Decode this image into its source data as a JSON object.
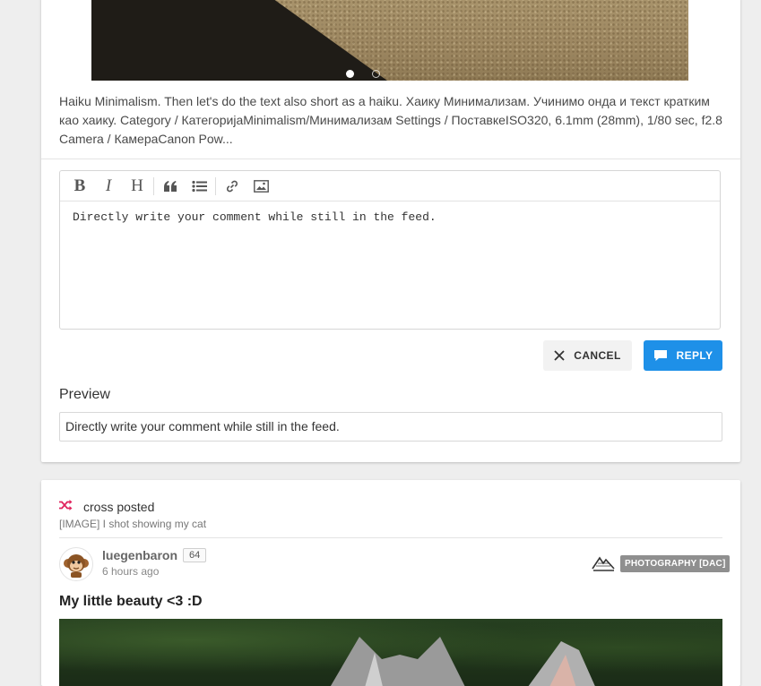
{
  "feed_post": {
    "carousel": {
      "slide_count": 2,
      "active_slide": 1
    },
    "excerpt": "Haiku Minimalism. Then let's do the text also short as a haiku. Хаику Минимализам. Учинимо онда и текст кратким као хаику. Category / КатегоријаMinimalism/Минимализам Settings / ПоставкеISO320, 6.1mm (28mm), 1/80 sec, f2.8 Camera / КамераCanon Pow..."
  },
  "comment_editor": {
    "toolbar_icons": [
      "bold-icon",
      "italic-icon",
      "heading-icon",
      "quote-icon",
      "unordered-list-icon",
      "link-icon",
      "image-icon"
    ],
    "toolbar_text": {
      "bold": "B",
      "italic": "I",
      "heading": "H"
    },
    "text": "Directly write your comment while still in the feed.",
    "cancel_label": "CANCEL",
    "reply_label": "REPLY",
    "preview_title": "Preview",
    "preview_text": "Directly write your comment while still in the feed."
  },
  "crosspost": {
    "label": "cross posted",
    "source": "[IMAGE] I shot showing my cat",
    "author": "luegenbaron",
    "reputation": "64",
    "time": "6 hours ago",
    "community": "PHOTOGRAPHY [DAC]",
    "title": "My little beauty <3 :D"
  },
  "colors": {
    "accent": "#1e90e8",
    "crosspost_icon": "#e0245e",
    "badge": "#8f8f8f",
    "background": "#eeeeee"
  }
}
